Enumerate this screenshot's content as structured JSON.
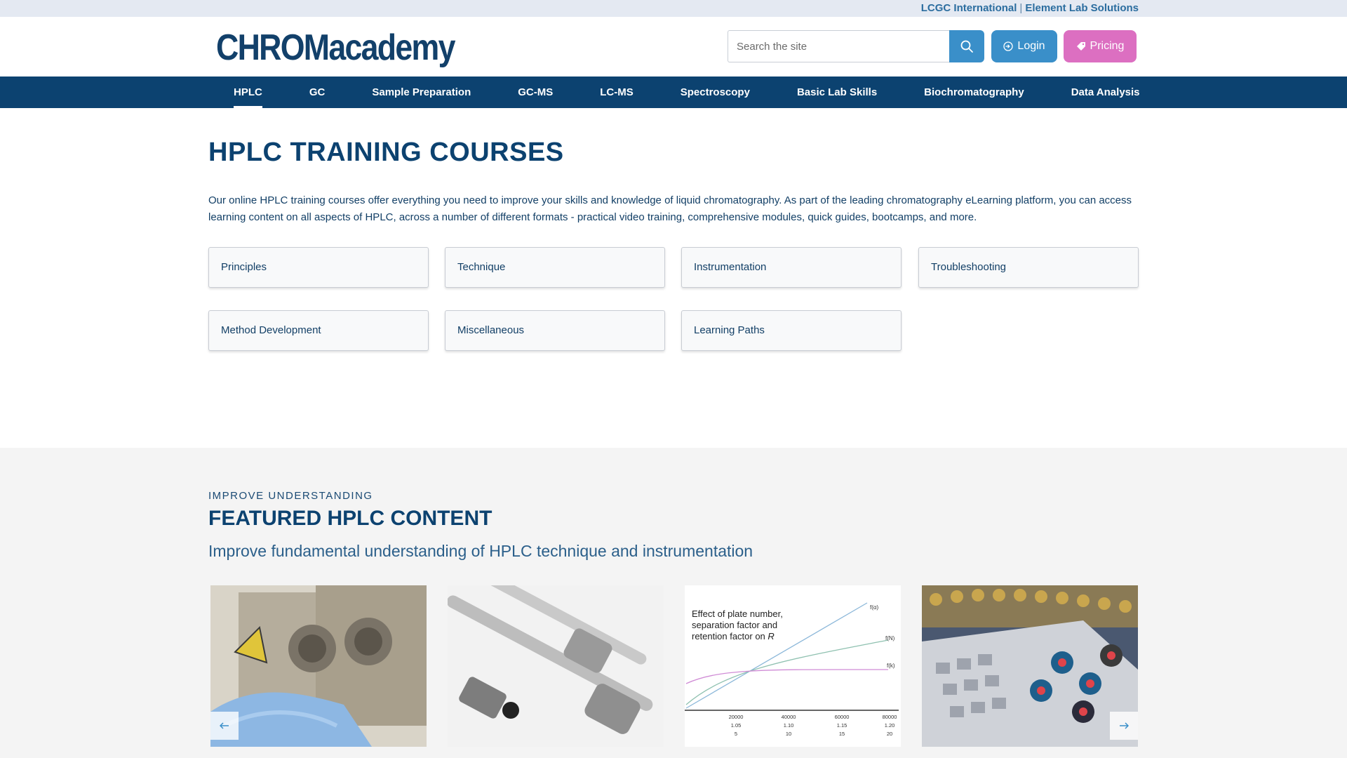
{
  "topbar": {
    "link1": "LCGC International",
    "separator": "|",
    "link2": "Element Lab Solutions"
  },
  "header": {
    "logo": "CHROMacademy",
    "search_placeholder": "Search the site",
    "login_label": "Login",
    "pricing_label": "Pricing"
  },
  "nav": {
    "items": [
      {
        "label": "HPLC"
      },
      {
        "label": "GC"
      },
      {
        "label": "Sample Preparation"
      },
      {
        "label": "GC-MS"
      },
      {
        "label": "LC-MS"
      },
      {
        "label": "Spectroscopy"
      },
      {
        "label": "Basic Lab Skills"
      },
      {
        "label": "Biochromatography"
      },
      {
        "label": "Data Analysis"
      }
    ],
    "active": "HPLC"
  },
  "main": {
    "title": "HPLC TRAINING COURSES",
    "intro": "Our online HPLC training courses offer everything you need to improve your skills and knowledge of liquid chromatography. As part of the leading chromatography eLearning platform, you can access learning content on all aspects of HPLC, across a number of different formats - practical video training, comprehensive modules, quick guides, bootcamps, and more.",
    "categories": [
      {
        "label": "Principles"
      },
      {
        "label": "Technique"
      },
      {
        "label": "Instrumentation"
      },
      {
        "label": "Troubleshooting"
      },
      {
        "label": "Method Development"
      },
      {
        "label": "Miscellaneous"
      },
      {
        "label": "Learning Paths"
      }
    ]
  },
  "featured": {
    "eyebrow": "IMPROVE UNDERSTANDING",
    "title": "FEATURED HPLC CONTENT",
    "subtitle": "Improve fundamental understanding of HPLC technique and instrumentation",
    "card3_chart": {
      "title_line1": "Effect of plate number,",
      "title_line2": "separation factor and",
      "title_line3": "retention factor on",
      "title_italic": "R",
      "curve_labels": [
        "f(α)",
        "f(N)",
        "f(k)"
      ],
      "x_ticks_row1": [
        "20000",
        "40000",
        "60000",
        "80000"
      ],
      "x_ticks_row2": [
        "1.05",
        "1.10",
        "1.15",
        "1.20"
      ],
      "x_ticks_row3": [
        "5",
        "10",
        "15",
        "20"
      ]
    }
  },
  "colors": {
    "navy": "#0c4270",
    "accent_blue": "#3a8fc9",
    "pricing_pink": "#dc6fc1"
  }
}
